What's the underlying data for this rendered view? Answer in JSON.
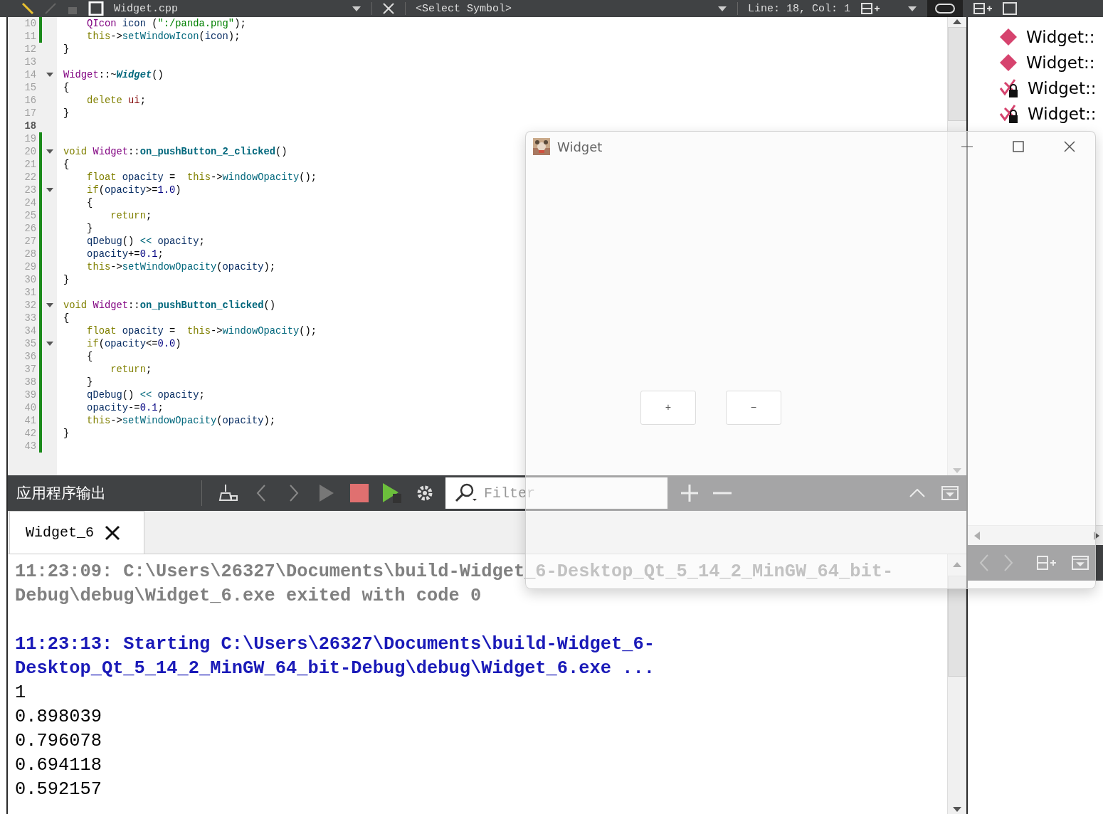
{
  "toolbar": {
    "file_name": "Widget.cpp",
    "symbol": "<Select Symbol>",
    "position": "Line: 18, Col: 1"
  },
  "editor": {
    "lines": [
      {
        "number": "10",
        "changed": true,
        "foldable": false,
        "current": false,
        "tokens": [
          {
            "text": "    QIcon",
            "kind": "type"
          },
          {
            "text": " icon",
            "kind": "var"
          },
          {
            "text": " (",
            "kind": "p"
          },
          {
            "text": "\":/panda.png\"",
            "kind": "str"
          },
          {
            "text": ");",
            "kind": "p"
          }
        ]
      },
      {
        "number": "11",
        "changed": true,
        "foldable": false,
        "current": false,
        "tokens": [
          {
            "text": "    this",
            "kind": "kw"
          },
          {
            "text": "->",
            "kind": "p"
          },
          {
            "text": "setWindowIcon",
            "kind": "fn"
          },
          {
            "text": "(",
            "kind": "p"
          },
          {
            "text": "icon",
            "kind": "var"
          },
          {
            "text": ");",
            "kind": "p"
          }
        ]
      },
      {
        "number": "12",
        "changed": false,
        "foldable": false,
        "current": false,
        "tokens": [
          {
            "text": "}",
            "kind": "p"
          }
        ]
      },
      {
        "number": "13",
        "changed": false,
        "foldable": false,
        "current": false
      },
      {
        "number": "14",
        "changed": false,
        "foldable": true,
        "current": false,
        "tokens": [
          {
            "text": "Widget",
            "kind": "type"
          },
          {
            "text": "::~",
            "kind": "p"
          },
          {
            "text": "Widget",
            "kind": "fnbi"
          },
          {
            "text": "()",
            "kind": "p"
          }
        ]
      },
      {
        "number": "15",
        "changed": false,
        "foldable": false,
        "current": false,
        "tokens": [
          {
            "text": "{",
            "kind": "p"
          }
        ]
      },
      {
        "number": "16",
        "changed": false,
        "foldable": false,
        "current": false,
        "tokens": [
          {
            "text": "    delete",
            "kind": "kw"
          },
          {
            "text": " ui",
            "kind": "member"
          },
          {
            "text": ";",
            "kind": "p"
          }
        ]
      },
      {
        "number": "17",
        "changed": false,
        "foldable": false,
        "current": false,
        "tokens": [
          {
            "text": "}",
            "kind": "p"
          }
        ]
      },
      {
        "number": "18",
        "changed": false,
        "foldable": false,
        "current": true
      },
      {
        "number": "19",
        "changed": true,
        "foldable": false,
        "current": false
      },
      {
        "number": "20",
        "changed": true,
        "foldable": true,
        "current": false,
        "tokens": [
          {
            "text": "void",
            "kind": "kw"
          },
          {
            "text": " Widget",
            "kind": "type"
          },
          {
            "text": "::",
            "kind": "p"
          },
          {
            "text": "on_pushButton_2_clicked",
            "kind": "fnb"
          },
          {
            "text": "()",
            "kind": "p"
          }
        ]
      },
      {
        "number": "21",
        "changed": true,
        "foldable": false,
        "current": false,
        "tokens": [
          {
            "text": "{",
            "kind": "p"
          }
        ]
      },
      {
        "number": "22",
        "changed": true,
        "foldable": false,
        "current": false,
        "tokens": [
          {
            "text": "    float",
            "kind": "kw"
          },
          {
            "text": " opacity",
            "kind": "var"
          },
          {
            "text": " =  ",
            "kind": "p"
          },
          {
            "text": "this",
            "kind": "kw"
          },
          {
            "text": "->",
            "kind": "p"
          },
          {
            "text": "windowOpacity",
            "kind": "fn"
          },
          {
            "text": "();",
            "kind": "p"
          }
        ]
      },
      {
        "number": "23",
        "changed": true,
        "foldable": true,
        "current": false,
        "tokens": [
          {
            "text": "    if",
            "kind": "kw"
          },
          {
            "text": "(",
            "kind": "p"
          },
          {
            "text": "opacity",
            "kind": "var"
          },
          {
            "text": ">=",
            "kind": "p"
          },
          {
            "text": "1.0",
            "kind": "num"
          },
          {
            "text": ")",
            "kind": "p"
          }
        ]
      },
      {
        "number": "24",
        "changed": true,
        "foldable": false,
        "current": false,
        "tokens": [
          {
            "text": "    {",
            "kind": "p"
          }
        ]
      },
      {
        "number": "25",
        "changed": true,
        "foldable": false,
        "current": false,
        "tokens": [
          {
            "text": "        return",
            "kind": "kw"
          },
          {
            "text": ";",
            "kind": "p"
          }
        ]
      },
      {
        "number": "26",
        "changed": true,
        "foldable": false,
        "current": false,
        "tokens": [
          {
            "text": "    }",
            "kind": "p"
          }
        ]
      },
      {
        "number": "27",
        "changed": true,
        "foldable": false,
        "current": false,
        "tokens": [
          {
            "text": "    qDebug",
            "kind": "var"
          },
          {
            "text": "() ",
            "kind": "p"
          },
          {
            "text": "<<",
            "kind": "op"
          },
          {
            "text": " opacity",
            "kind": "var"
          },
          {
            "text": ";",
            "kind": "p"
          }
        ]
      },
      {
        "number": "28",
        "changed": true,
        "foldable": false,
        "current": false,
        "tokens": [
          {
            "text": "    opacity",
            "kind": "var"
          },
          {
            "text": "+=",
            "kind": "p"
          },
          {
            "text": "0.1",
            "kind": "num"
          },
          {
            "text": ";",
            "kind": "p"
          }
        ]
      },
      {
        "number": "29",
        "changed": true,
        "foldable": false,
        "current": false,
        "tokens": [
          {
            "text": "    this",
            "kind": "kw"
          },
          {
            "text": "->",
            "kind": "p"
          },
          {
            "text": "setWindowOpacity",
            "kind": "fn"
          },
          {
            "text": "(",
            "kind": "p"
          },
          {
            "text": "opacity",
            "kind": "var"
          },
          {
            "text": ");",
            "kind": "p"
          }
        ]
      },
      {
        "number": "30",
        "changed": true,
        "foldable": false,
        "current": false,
        "tokens": [
          {
            "text": "}",
            "kind": "p"
          }
        ]
      },
      {
        "number": "31",
        "changed": true,
        "foldable": false,
        "current": false
      },
      {
        "number": "32",
        "changed": true,
        "foldable": true,
        "current": false,
        "tokens": [
          {
            "text": "void",
            "kind": "kw"
          },
          {
            "text": " Widget",
            "kind": "type"
          },
          {
            "text": "::",
            "kind": "p"
          },
          {
            "text": "on_pushButton_clicked",
            "kind": "fnb"
          },
          {
            "text": "()",
            "kind": "p"
          }
        ]
      },
      {
        "number": "33",
        "changed": true,
        "foldable": false,
        "current": false,
        "tokens": [
          {
            "text": "{",
            "kind": "p"
          }
        ]
      },
      {
        "number": "34",
        "changed": true,
        "foldable": false,
        "current": false,
        "tokens": [
          {
            "text": "    float",
            "kind": "kw"
          },
          {
            "text": " opacity",
            "kind": "var"
          },
          {
            "text": " =  ",
            "kind": "p"
          },
          {
            "text": "this",
            "kind": "kw"
          },
          {
            "text": "->",
            "kind": "p"
          },
          {
            "text": "windowOpacity",
            "kind": "fn"
          },
          {
            "text": "();",
            "kind": "p"
          }
        ]
      },
      {
        "number": "35",
        "changed": true,
        "foldable": true,
        "current": false,
        "tokens": [
          {
            "text": "    if",
            "kind": "kw"
          },
          {
            "text": "(",
            "kind": "p"
          },
          {
            "text": "opacity",
            "kind": "var"
          },
          {
            "text": "<=",
            "kind": "p"
          },
          {
            "text": "0.0",
            "kind": "num"
          },
          {
            "text": ")",
            "kind": "p"
          }
        ]
      },
      {
        "number": "36",
        "changed": true,
        "foldable": false,
        "current": false,
        "tokens": [
          {
            "text": "    {",
            "kind": "p"
          }
        ]
      },
      {
        "number": "37",
        "changed": true,
        "foldable": false,
        "current": false,
        "tokens": [
          {
            "text": "        return",
            "kind": "kw"
          },
          {
            "text": ";",
            "kind": "p"
          }
        ]
      },
      {
        "number": "38",
        "changed": true,
        "foldable": false,
        "current": false,
        "tokens": [
          {
            "text": "    }",
            "kind": "p"
          }
        ]
      },
      {
        "number": "39",
        "changed": true,
        "foldable": false,
        "current": false,
        "tokens": [
          {
            "text": "    qDebug",
            "kind": "var"
          },
          {
            "text": "() ",
            "kind": "p"
          },
          {
            "text": "<<",
            "kind": "op"
          },
          {
            "text": " opacity",
            "kind": "var"
          },
          {
            "text": ";",
            "kind": "p"
          }
        ]
      },
      {
        "number": "40",
        "changed": true,
        "foldable": false,
        "current": false,
        "tokens": [
          {
            "text": "    opacity",
            "kind": "var"
          },
          {
            "text": "-=",
            "kind": "p"
          },
          {
            "text": "0.1",
            "kind": "num"
          },
          {
            "text": ";",
            "kind": "p"
          }
        ]
      },
      {
        "number": "41",
        "changed": true,
        "foldable": false,
        "current": false,
        "tokens": [
          {
            "text": "    this",
            "kind": "kw"
          },
          {
            "text": "->",
            "kind": "p"
          },
          {
            "text": "setWindowOpacity",
            "kind": "fn"
          },
          {
            "text": "(",
            "kind": "p"
          },
          {
            "text": "opacity",
            "kind": "var"
          },
          {
            "text": ");",
            "kind": "p"
          }
        ]
      },
      {
        "number": "42",
        "changed": true,
        "foldable": false,
        "current": false,
        "tokens": [
          {
            "text": "}",
            "kind": "p"
          }
        ]
      },
      {
        "number": "43",
        "changed": true,
        "foldable": false,
        "current": false
      }
    ]
  },
  "outline": [
    {
      "name": "Widget::",
      "kind": "method"
    },
    {
      "name": "Widget::",
      "kind": "method"
    },
    {
      "name": "Widget::",
      "kind": "private_slot"
    },
    {
      "name": "Widget::",
      "kind": "private_slot"
    }
  ],
  "output_pane": {
    "title": "应用程序输出",
    "filter": {
      "placeholder": "Filter"
    },
    "tabs": [
      {
        "label": "Widget_6",
        "selected": true
      }
    ],
    "blocks": [
      {
        "kind": "exit",
        "lines": [
          "11:23:09: C:\\Users\\26327\\Documents\\build-Widget_6-Desktop_Qt_5_14_2_MinGW_64_bit-",
          "Debug\\debug\\Widget_6.exe exited with code 0"
        ]
      },
      {
        "kind": "start",
        "lines": [
          "11:23:13: Starting C:\\Users\\26327\\Documents\\build-Widget_6-",
          "Desktop_Qt_5_14_2_MinGW_64_bit-Debug\\debug\\Widget_6.exe ..."
        ]
      },
      {
        "kind": "plain",
        "lines": [
          "1",
          "0.898039",
          "0.796078",
          "0.694118",
          "0.592157"
        ]
      }
    ]
  },
  "widget_window": {
    "title": "Widget",
    "buttons": [
      "+",
      "−"
    ]
  }
}
